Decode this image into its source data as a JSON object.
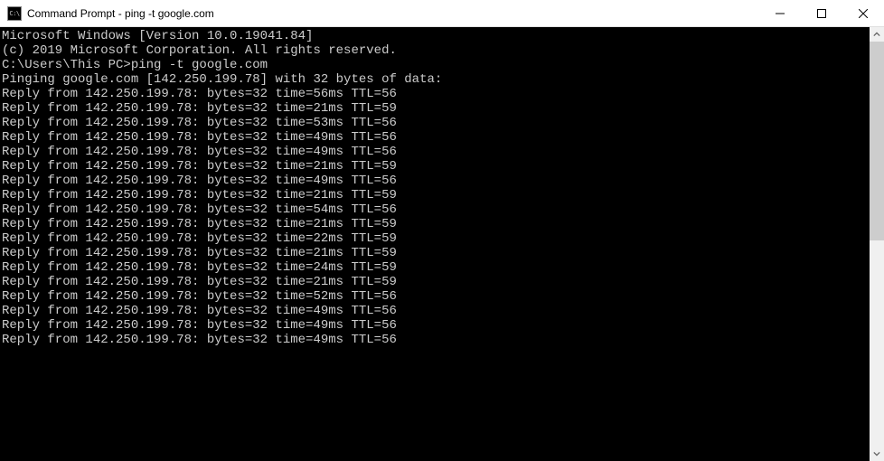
{
  "window": {
    "icon_text": "C:\\",
    "title": "Command Prompt - ping  -t google.com"
  },
  "terminal": {
    "header_line1": "Microsoft Windows [Version 10.0.19041.84]",
    "header_line2": "(c) 2019 Microsoft Corporation. All rights reserved.",
    "prompt_path": "C:\\Users\\This PC>",
    "command": "ping -t google.com",
    "ping_header": "Pinging google.com [142.250.199.78] with 32 bytes of data:",
    "ping_ip": "142.250.199.78",
    "replies": [
      {
        "bytes": 32,
        "time_ms": 56,
        "ttl": 56
      },
      {
        "bytes": 32,
        "time_ms": 21,
        "ttl": 59
      },
      {
        "bytes": 32,
        "time_ms": 53,
        "ttl": 56
      },
      {
        "bytes": 32,
        "time_ms": 49,
        "ttl": 56
      },
      {
        "bytes": 32,
        "time_ms": 49,
        "ttl": 56
      },
      {
        "bytes": 32,
        "time_ms": 21,
        "ttl": 59
      },
      {
        "bytes": 32,
        "time_ms": 49,
        "ttl": 56
      },
      {
        "bytes": 32,
        "time_ms": 21,
        "ttl": 59
      },
      {
        "bytes": 32,
        "time_ms": 54,
        "ttl": 56
      },
      {
        "bytes": 32,
        "time_ms": 21,
        "ttl": 59
      },
      {
        "bytes": 32,
        "time_ms": 22,
        "ttl": 59
      },
      {
        "bytes": 32,
        "time_ms": 21,
        "ttl": 59
      },
      {
        "bytes": 32,
        "time_ms": 24,
        "ttl": 59
      },
      {
        "bytes": 32,
        "time_ms": 21,
        "ttl": 59
      },
      {
        "bytes": 32,
        "time_ms": 52,
        "ttl": 56
      },
      {
        "bytes": 32,
        "time_ms": 49,
        "ttl": 56
      },
      {
        "bytes": 32,
        "time_ms": 49,
        "ttl": 56
      },
      {
        "bytes": 32,
        "time_ms": 49,
        "ttl": 56
      }
    ]
  }
}
